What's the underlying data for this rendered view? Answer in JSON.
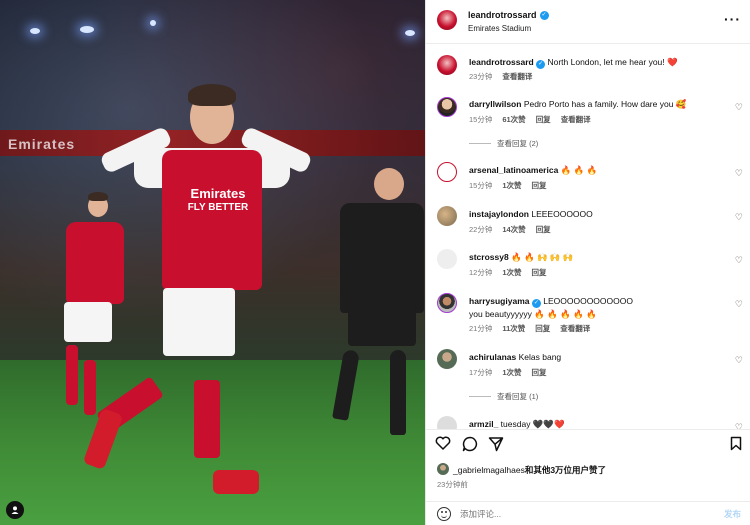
{
  "post": {
    "username": "leandrotrossard",
    "location": "Emirates Stadium",
    "caption": "North London, let me hear you! ❤️",
    "caption_time": "23分钟",
    "caption_translate": "查看翻译",
    "photo_sponsor_1": "Emirates",
    "photo_sponsor_2": "FLY BETTER",
    "photo_banner": "Emirates"
  },
  "comments": [
    {
      "user": "darryllwilson",
      "text": "Pedro Porto has a family. How dare you 🥰",
      "time": "15分钟",
      "likes": "61次赞",
      "reply": "回复",
      "translate": "查看翻译",
      "view_replies": "查看回复 (2)"
    },
    {
      "user": "arsenal_latinoamerica",
      "text": "🔥 🔥 🔥",
      "time": "15分钟",
      "likes": "1次赞",
      "reply": "回复"
    },
    {
      "user": "instajaylondon",
      "text": "LEEEOOOOOO",
      "time": "22分钟",
      "likes": "14次赞",
      "reply": "回复"
    },
    {
      "user": "stcrossy8",
      "text": "🔥 🔥 🙌 🙌 🙌",
      "time": "12分钟",
      "likes": "1次赞",
      "reply": "回复"
    },
    {
      "user": "harrysugiyama",
      "text": "LEOOOOOOOOOOOO you beautyyyyyy 🔥 🔥 🔥 🔥 🔥",
      "time": "21分钟",
      "likes": "11次赞",
      "reply": "回复",
      "translate": "查看翻译"
    },
    {
      "user": "achirulanas",
      "text": "Kelas bang",
      "time": "17分钟",
      "likes": "1次赞",
      "reply": "回复",
      "view_replies": "查看回复 (1)"
    },
    {
      "user": "armzil_",
      "text": "tuesday 🖤🖤❤️"
    }
  ],
  "likes": {
    "text_user": "_gabrielmagalhaes",
    "text_rest": "和其他3万位用户赞了",
    "time": "23分钟前"
  },
  "add_comment": {
    "placeholder": "添加评论...",
    "post_label": "发布"
  },
  "icons": [
    "more-icon",
    "heart-icon",
    "comment-icon",
    "share-icon",
    "bookmark-icon",
    "emoji-icon",
    "verified-icon",
    "user-tag-icon"
  ],
  "colors": {
    "verified": "#1d9bf0",
    "arsenal_red": "#c8102e",
    "caption_heart": "#e0245e"
  }
}
